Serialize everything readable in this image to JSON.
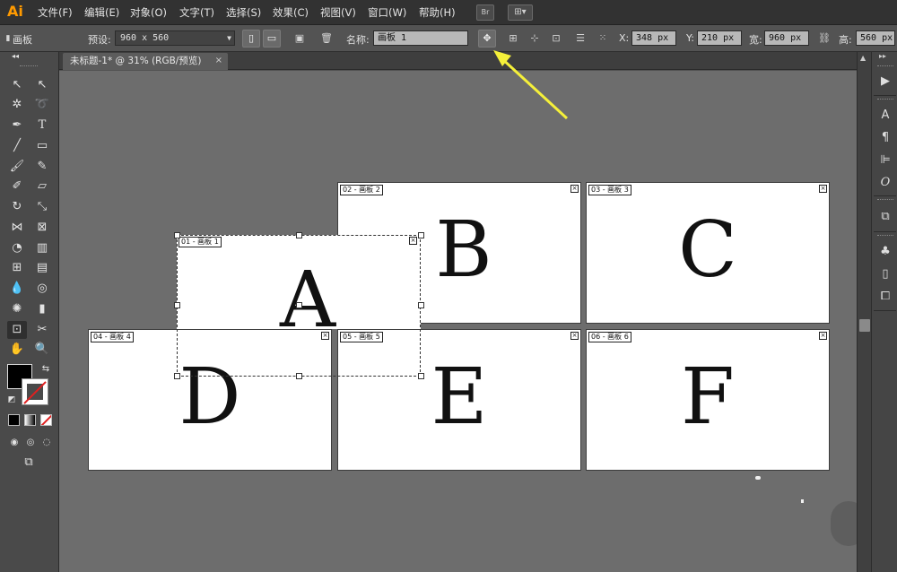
{
  "app": {
    "logo": "Ai"
  },
  "menu": [
    "文件(F)",
    "编辑(E)",
    "对象(O)",
    "文字(T)",
    "选择(S)",
    "效果(C)",
    "视图(V)",
    "窗口(W)",
    "帮助(H)"
  ],
  "menubar_buttons": {
    "bridge": "Br",
    "workspace": "⊞▾"
  },
  "controlbar": {
    "panel_name": "画板",
    "preset_label": "预设:",
    "preset_value": "960 x 560",
    "name_label": "名称:",
    "name_value": "画板 1",
    "x_label": "X:",
    "x_value": "348 px",
    "y_label": "Y:",
    "y_value": "210 px",
    "w_label": "宽:",
    "w_value": "960 px",
    "h_label": "高:",
    "h_value": "560 px"
  },
  "document_tab": {
    "title": "未标题-1* @ 31% (RGB/预览)",
    "close": "×"
  },
  "artboards": [
    {
      "label": "01 - 画板 1",
      "letter": "A"
    },
    {
      "label": "02 - 画板 2",
      "letter": "B"
    },
    {
      "label": "03 - 画板 3",
      "letter": "C"
    },
    {
      "label": "04 - 画板 4",
      "letter": "D"
    },
    {
      "label": "05 - 画板 5",
      "letter": "E"
    },
    {
      "label": "06 - 画板 6",
      "letter": "F"
    }
  ],
  "colors": {
    "accent_arrow": "#f5f03a",
    "logo": "#ff9a00",
    "canvas": "#6d6d6d"
  }
}
